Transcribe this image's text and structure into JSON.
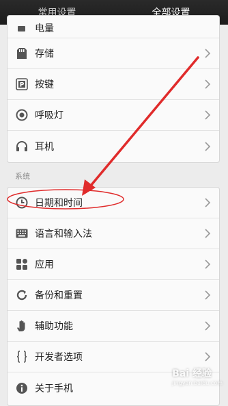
{
  "tabs": [
    {
      "label": "常用设置",
      "active": false
    },
    {
      "label": "全部设置",
      "active": true
    }
  ],
  "group1": {
    "partial_label": "电量",
    "items": [
      {
        "label": "存储",
        "icon": "storage-icon"
      },
      {
        "label": "按键",
        "icon": "keys-icon"
      },
      {
        "label": "呼吸灯",
        "icon": "breathing-light-icon"
      },
      {
        "label": "耳机",
        "icon": "headphones-icon"
      }
    ]
  },
  "section_title": "系统",
  "group2": {
    "items": [
      {
        "label": "日期和时间",
        "icon": "clock-icon",
        "highlighted": true
      },
      {
        "label": "语言和输入法",
        "icon": "keyboard-icon"
      },
      {
        "label": "应用",
        "icon": "apps-icon"
      },
      {
        "label": "备份和重置",
        "icon": "backup-icon"
      },
      {
        "label": "辅助功能",
        "icon": "hand-icon"
      },
      {
        "label": "开发者选项",
        "icon": "braces-icon"
      },
      {
        "label": "关于手机",
        "icon": "info-icon"
      }
    ]
  },
  "annotation_color": "#e02b2b",
  "watermark": {
    "brand": "Bai 经验",
    "sub": "jingyan.baidu.com"
  }
}
